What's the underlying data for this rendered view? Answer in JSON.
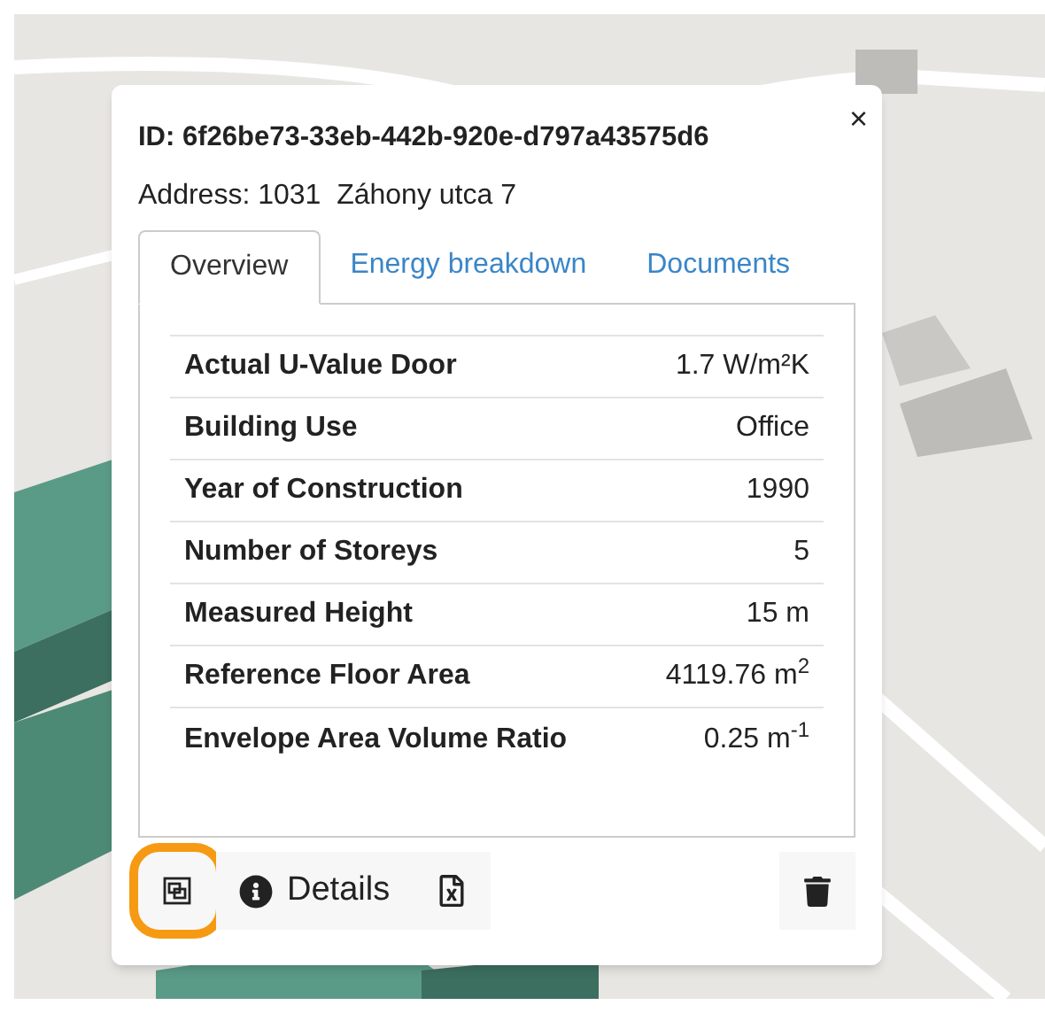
{
  "popup": {
    "close": "×",
    "id_line": "ID: 6f26be73-33eb-442b-920e-d797a43575d6",
    "address": "Address: 1031  Záhony utca 7",
    "tabs": [
      {
        "label": "Overview",
        "selected": true
      },
      {
        "label": "Energy breakdown",
        "selected": false
      },
      {
        "label": "Documents",
        "selected": false
      }
    ],
    "rows": [
      {
        "label": "Actual U-Value Door",
        "value": "1.7 W/m²K"
      },
      {
        "label": "Building Use",
        "value": "Office"
      },
      {
        "label": "Year of Construction",
        "value": "1990"
      },
      {
        "label": "Number of Storeys",
        "value": "5"
      },
      {
        "label": "Measured Height",
        "value": "15 m"
      },
      {
        "label": "Reference Floor Area",
        "value": "4119.76 m$^{2}$"
      },
      {
        "label": "Envelope Area Volume Ratio",
        "value": "0.25 m$^{-1}$"
      }
    ],
    "actions": [
      {
        "kind": "frame",
        "highlighted": true
      },
      {
        "kind": "details",
        "label": "Details",
        "highlighted": false
      },
      {
        "kind": "excel",
        "highlighted": false
      },
      {
        "kind": "delete",
        "highlighted": false
      }
    ]
  }
}
